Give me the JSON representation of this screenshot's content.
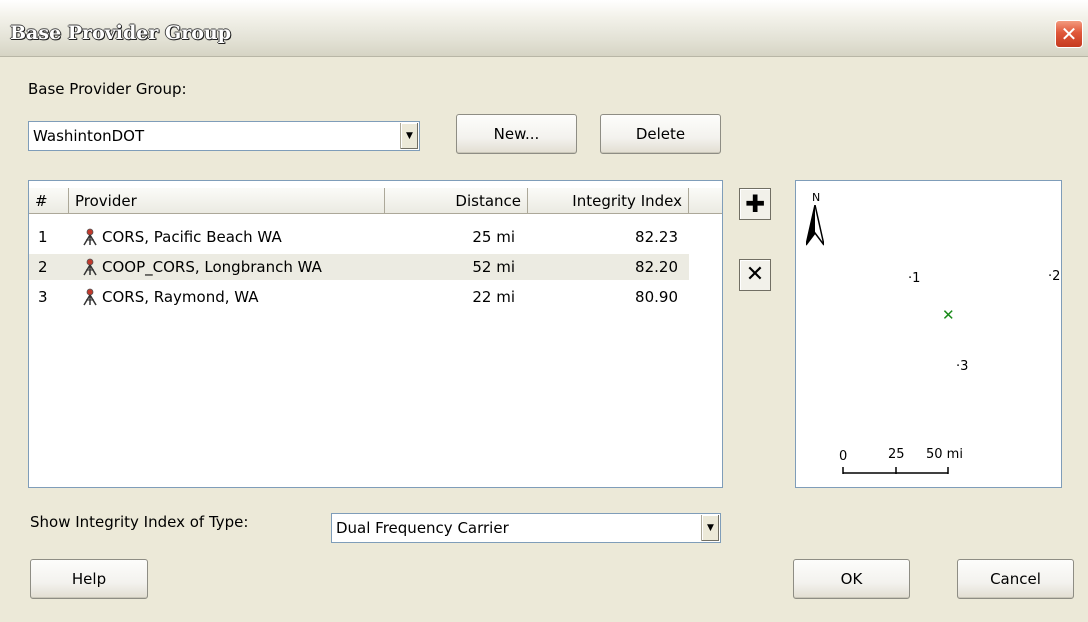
{
  "window": {
    "title": "Base Provider Group",
    "close_icon": "close-icon"
  },
  "group": {
    "label": "Base Provider Group:",
    "selected": "WashintonDOT",
    "new_label": "New...",
    "delete_label": "Delete"
  },
  "table": {
    "headers": [
      "#",
      "Provider",
      "Distance",
      "Integrity Index"
    ],
    "rows": [
      {
        "num": "1",
        "provider": "CORS, Pacific Beach WA",
        "distance": "25 mi",
        "index": "82.23",
        "icon": "survey-tripod-icon"
      },
      {
        "num": "2",
        "provider": "COOP_CORS, Longbranch WA",
        "distance": "52 mi",
        "index": "82.20",
        "icon": "survey-tripod-icon",
        "selected": true
      },
      {
        "num": "3",
        "provider": "CORS, Raymond, WA",
        "distance": "22 mi",
        "index": "80.90",
        "icon": "survey-tripod-icon"
      }
    ]
  },
  "tools": {
    "add_icon": "plus-icon",
    "remove_icon": "x-remove-icon"
  },
  "map": {
    "north_label": "N",
    "points": [
      "1",
      "2",
      "3"
    ],
    "scale_labels": [
      "0",
      "25",
      "50 mi"
    ],
    "marker_color": "#1a8a1a"
  },
  "integrity": {
    "label": "Show Integrity Index of Type:",
    "selected": "Dual Frequency Carrier"
  },
  "footer": {
    "help_label": "Help",
    "ok_label": "OK",
    "cancel_label": "Cancel"
  }
}
